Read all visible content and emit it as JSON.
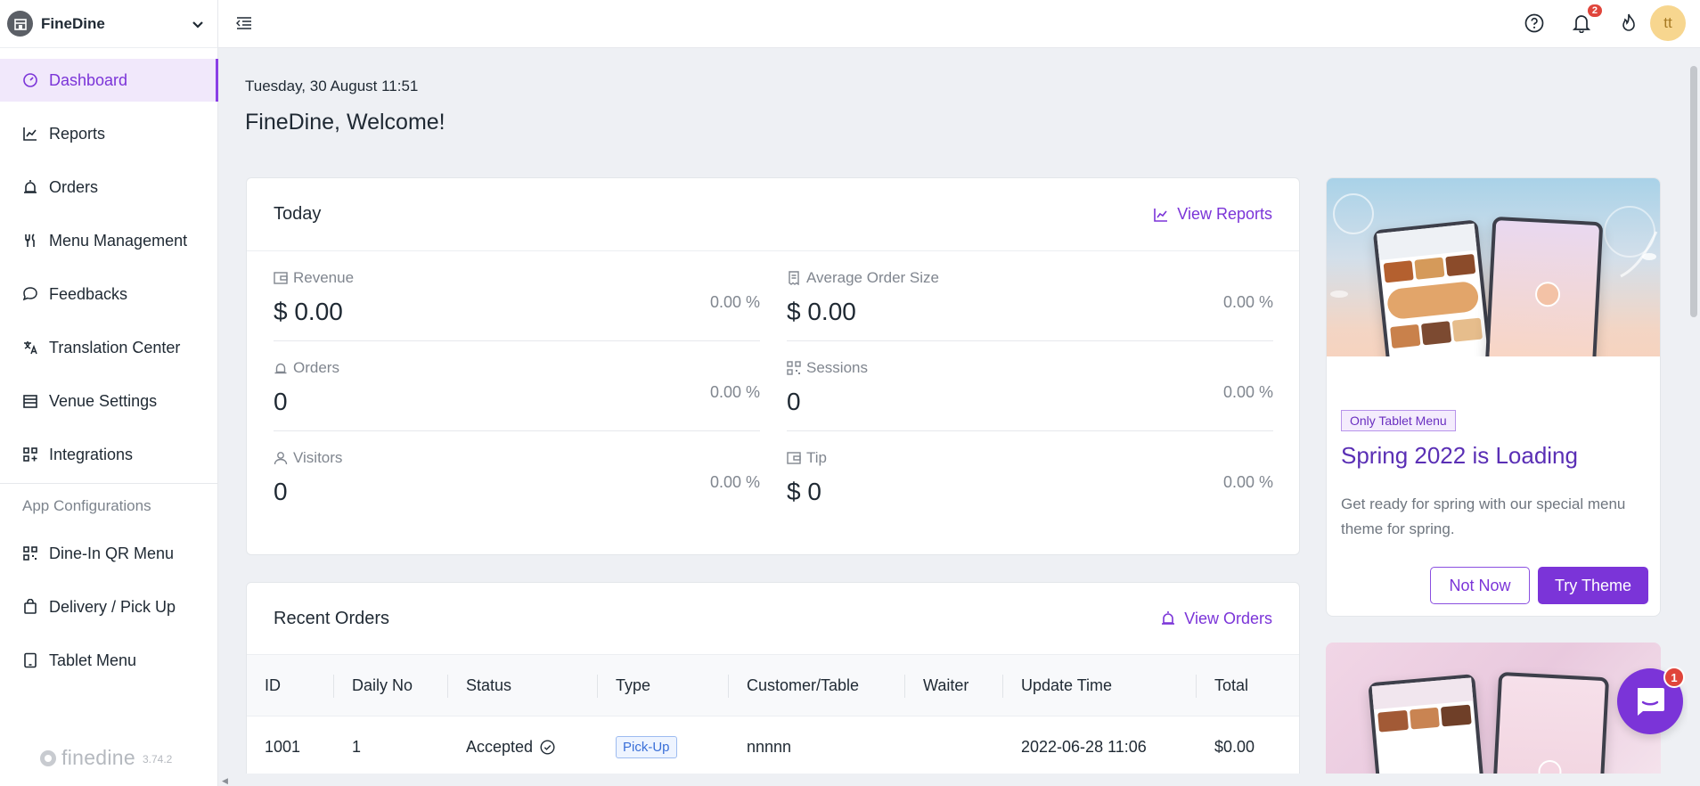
{
  "venue": {
    "name": "FineDine"
  },
  "sidebar": {
    "items": [
      {
        "label": "Dashboard",
        "icon": "dashboard-icon",
        "active": true
      },
      {
        "label": "Reports",
        "icon": "chart-line-icon"
      },
      {
        "label": "Orders",
        "icon": "alarm-icon"
      },
      {
        "label": "Menu Management",
        "icon": "fork-knife-icon"
      },
      {
        "label": "Feedbacks",
        "icon": "chat-icon"
      },
      {
        "label": "Translation Center",
        "icon": "translate-icon"
      },
      {
        "label": "Venue Settings",
        "icon": "store-icon"
      },
      {
        "label": "Integrations",
        "icon": "grid-plus-icon"
      }
    ],
    "section_label": "App Configurations",
    "app_items": [
      {
        "label": "Dine-In QR Menu",
        "icon": "qr-icon"
      },
      {
        "label": "Delivery / Pick Up",
        "icon": "bag-icon"
      },
      {
        "label": "Tablet Menu",
        "icon": "tablet-icon"
      }
    ],
    "brand": {
      "logo_text": "finedine",
      "version": "3.74.2"
    }
  },
  "topbar": {
    "notifications_count": "2",
    "avatar_initials": "tt"
  },
  "header": {
    "date": "Tuesday, 30 August 11:51",
    "welcome": "FineDine, Welcome!"
  },
  "today": {
    "title": "Today",
    "link": "View Reports",
    "stats": [
      {
        "label": "Revenue",
        "value": "$ 0.00",
        "pct": "0.00 %",
        "icon": "wallet-icon"
      },
      {
        "label": "Average Order Size",
        "value": "$ 0.00",
        "pct": "0.00 %",
        "icon": "receipt-icon"
      },
      {
        "label": "Orders",
        "value": "0",
        "pct": "0.00 %",
        "icon": "alarm-icon"
      },
      {
        "label": "Sessions",
        "value": "0",
        "pct": "0.00 %",
        "icon": "qr-icon"
      },
      {
        "label": "Visitors",
        "value": "0",
        "pct": "0.00 %",
        "icon": "user-icon"
      },
      {
        "label": "Tip",
        "value": "$ 0",
        "pct": "0.00 %",
        "icon": "wallet-icon"
      }
    ]
  },
  "recent_orders": {
    "title": "Recent Orders",
    "link": "View Orders",
    "columns": [
      "ID",
      "Daily No",
      "Status",
      "Type",
      "Customer/Table",
      "Waiter",
      "Update Time",
      "Total"
    ],
    "rows": [
      {
        "id": "1001",
        "daily_no": "1",
        "status": "Accepted",
        "type": "Pick-Up",
        "customer": "nnnnn",
        "waiter": "",
        "update_time": "2022-06-28 11:06",
        "total": "$0.00"
      }
    ]
  },
  "promo": {
    "tag": "Only Tablet Menu",
    "title": "Spring 2022 is Loading",
    "text": "Get ready for spring with our special menu theme for spring.",
    "btn_secondary": "Not Now",
    "btn_primary": "Try Theme"
  },
  "chat": {
    "badge": "1"
  },
  "colors": {
    "accent": "#7b34d8",
    "active_bg": "#f1e8fb",
    "badge": "#e0453b",
    "page_bg": "#eef0f4"
  }
}
